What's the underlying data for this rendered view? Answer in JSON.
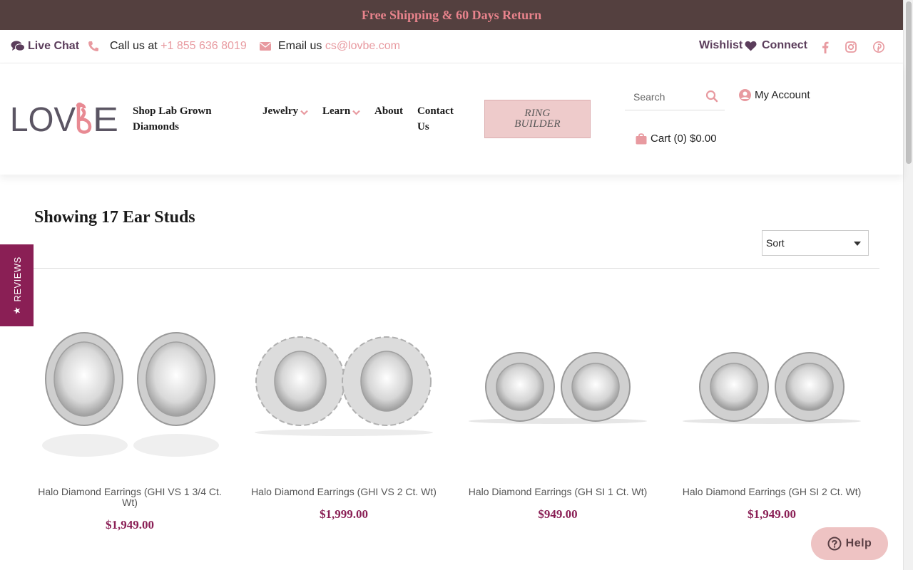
{
  "promo": {
    "text": "Free Shipping & 60 Days Return"
  },
  "utility": {
    "live_chat": "Live Chat",
    "call_prefix": "Call us at",
    "phone": "+1 855 636 8019",
    "email_prefix": "Email us",
    "email": "cs@lovbe.com",
    "wishlist": "Wishlist",
    "connect": "Connect",
    "social_icons": [
      "facebook-icon",
      "instagram-icon",
      "pinterest-icon"
    ]
  },
  "header": {
    "logo_text": "LOVBE",
    "nav": {
      "shop_line1": "Shop Lab Grown",
      "shop_line2": "Diamonds",
      "jewelry": "Jewelry",
      "learn": "Learn",
      "about": "About",
      "contact_line1": "Contact",
      "contact_line2": "Us"
    },
    "ring_builder_line1": "RING",
    "ring_builder_line2": "BUILDER",
    "search_placeholder": "Search",
    "account": "My Account",
    "cart": "Cart (0) $0.00"
  },
  "listing": {
    "title": "Showing 17 Ear Studs",
    "sort_label": "Sort",
    "products": [
      {
        "name": "Halo Diamond Earrings (GHI VS 1 3/4 Ct. Wt)",
        "price": "$1,949.00"
      },
      {
        "name": "Halo Diamond Earrings (GHI VS 2 Ct. Wt)",
        "price": "$1,999.00"
      },
      {
        "name": "Halo Diamond Earrings (GH SI 1 Ct. Wt)",
        "price": "$949.00"
      },
      {
        "name": "Halo Diamond Earrings (GH SI 2 Ct. Wt)",
        "price": "$1,949.00"
      }
    ]
  },
  "reviews_tab": "REVIEWS",
  "help_button": "Help",
  "colors": {
    "promo_bg": "#54403f",
    "promo_text": "#e8838c",
    "brand_plum": "#5b3d5b",
    "accent_pink": "#e89aa0",
    "price": "#8a1f55",
    "ring_builder_bg": "#eecbcb"
  }
}
